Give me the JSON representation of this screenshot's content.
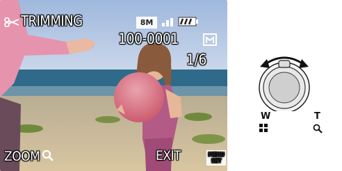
{
  "screen": {
    "mode_label": "TRIMMING",
    "picture_size": "8M",
    "folder_file": "100-0001",
    "image_count": "1/6",
    "zoom_label": "ZOOM",
    "exit_label": "EXIT",
    "menu_set_text": "MENU SET",
    "battery_level": 1.0,
    "icons": [
      "scissors-icon",
      "quality-icon",
      "battery-icon",
      "protect-icon",
      "zoom-icon",
      "menu-set-icon"
    ]
  },
  "diagram": {
    "wide_label": "W",
    "tele_label": "T",
    "icons": [
      "lever-arrow-icon",
      "wide-multi-icon",
      "tele-zoom-icon"
    ]
  },
  "colors": {
    "sky": "#b9cbe6",
    "sea": "#2f6a8a",
    "sand": "#c9b48f",
    "ball": "#d8707e",
    "girl_top": "#b35a86",
    "sleeve_left": "#e48aa6"
  }
}
